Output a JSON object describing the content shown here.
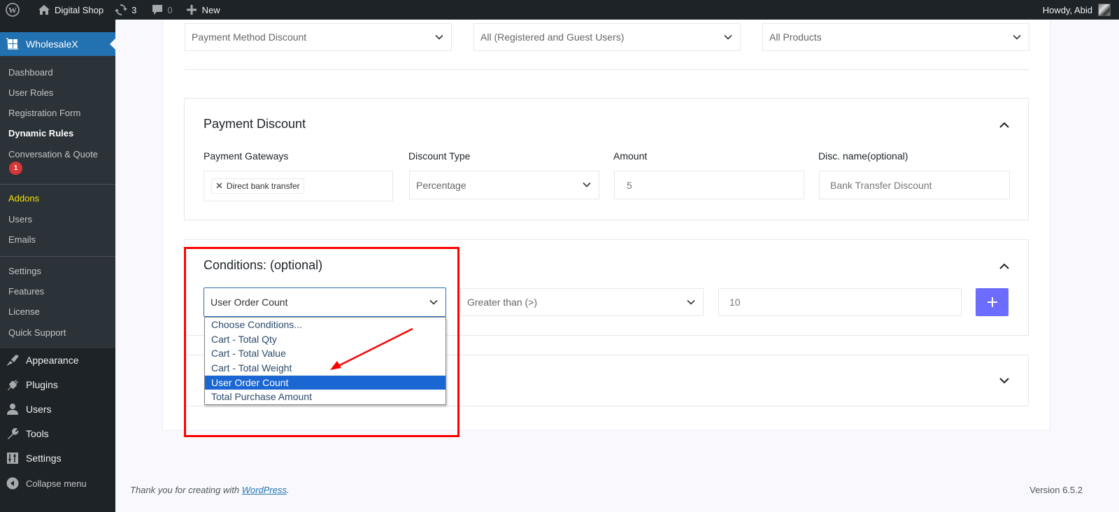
{
  "adminbar": {
    "site_name": "Digital Shop",
    "updates_count": "3",
    "comments_count": "0",
    "new_label": "New",
    "greeting": "Howdy, Abid"
  },
  "sidebar": {
    "plugin_label": "WholesaleX",
    "submenu": [
      {
        "label": "Dashboard"
      },
      {
        "label": "User Roles"
      },
      {
        "label": "Registration Form"
      },
      {
        "label": "Dynamic Rules",
        "current": true
      },
      {
        "label": "Conversation & Quote",
        "badge": "1"
      },
      {
        "label": "Addons",
        "highlight": true
      },
      {
        "label": "Users"
      },
      {
        "label": "Emails"
      },
      {
        "label": "Settings"
      },
      {
        "label": "Features"
      },
      {
        "label": "License"
      },
      {
        "label": "Quick Support"
      }
    ],
    "menu": [
      {
        "label": "Appearance",
        "icon": "paintbrush-icon"
      },
      {
        "label": "Plugins",
        "icon": "plugin-icon"
      },
      {
        "label": "Users",
        "icon": "user-icon"
      },
      {
        "label": "Tools",
        "icon": "wrench-icon"
      },
      {
        "label": "Settings",
        "icon": "settings-sliders-icon"
      },
      {
        "label": "Collapse menu",
        "icon": "collapse-icon"
      }
    ]
  },
  "rule": {
    "rule_type": "Payment Method Discount",
    "user_scope": "All (Registered and Guest Users)",
    "product_scope": "All Products"
  },
  "payment_discount": {
    "title": "Payment Discount",
    "gateways_label": "Payment Gateways",
    "gateway_chips": [
      "Direct bank transfer"
    ],
    "discount_type_label": "Discount Type",
    "discount_type_value": "Percentage",
    "amount_label": "Amount",
    "amount_value": "5",
    "disc_name_label": "Disc. name(optional)",
    "disc_name_value": "Bank Transfer Discount"
  },
  "conditions": {
    "title": "Conditions: (optional)",
    "condition_value": "User Order Count",
    "operator_value": "Greater than (>)",
    "amount_value": "10",
    "add_label": "+",
    "options": [
      "Choose Conditions...",
      "Cart - Total Qty",
      "Cart - Total Value",
      "Cart - Total Weight",
      "User Order Count",
      "Total Purchase Amount"
    ],
    "selected_option_index": 4
  },
  "footer": {
    "thanks_prefix": "Thank you for creating with ",
    "thanks_link": "WordPress",
    "thanks_suffix": ".",
    "version": "Version 6.5.2"
  },
  "colors": {
    "admin_dark": "#1d2327",
    "accent_blue": "#2271b1",
    "add_button": "#6c6cff",
    "option_selected": "#1a66d2",
    "annotation_red": "#ff0000"
  }
}
